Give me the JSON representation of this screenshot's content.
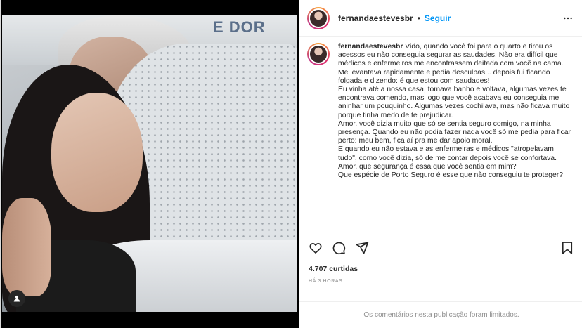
{
  "post": {
    "username": "fernandaestevesbr",
    "follow_label": "Seguir",
    "separator": "•",
    "photo_sign_text": "E DOR",
    "caption_username": "fernandaestevesbr",
    "caption_body": "Vido, quando você foi para o quarto e tirou os acessos eu não conseguia segurar as saudades. Não era difícil que médicos e enfermeiros me encontrassem deitada com você na cama. Me levantava rapidamente e pedia desculpas... depois fui ficando folgada e dizendo: é que estou com saudades!\nEu vinha até a nossa casa, tomava banho e voltava, algumas vezes te encontrava comendo, mas logo que você acabava eu conseguia me aninhar um pouquinho. Algumas vezes cochilava, mas não ficava muito porque tinha medo de te prejudicar.\nAmor, você dizia muito que só se sentia seguro comigo, na minha presença. Quando eu não podia fazer nada você só me pedia para ficar perto: meu bem, fica aí pra me dar apoio moral.\nE quando eu não estava e as enfermeiras e médicos \"atropelavam tudo\", como você dizia, só de me contar depois você se confortava.\nAmor, que segurança é essa que você sentia em mim?\nQue espécie de Porto Seguro é esse que não conseguiu te proteger?",
    "likes_text": "4.707 curtidas",
    "time_text": "HÁ 3 HORAS",
    "comments_limited_text": "Os comentários nesta publicação foram limitados."
  },
  "icons": {
    "more": "more-options-icon",
    "like": "heart-icon",
    "comment": "comment-icon",
    "share": "share-icon",
    "save": "bookmark-icon",
    "tag": "user-tag-icon"
  },
  "colors": {
    "accent": "#0095f6",
    "text": "#262626",
    "muted": "#8e8e8e",
    "border": "#efefef"
  }
}
